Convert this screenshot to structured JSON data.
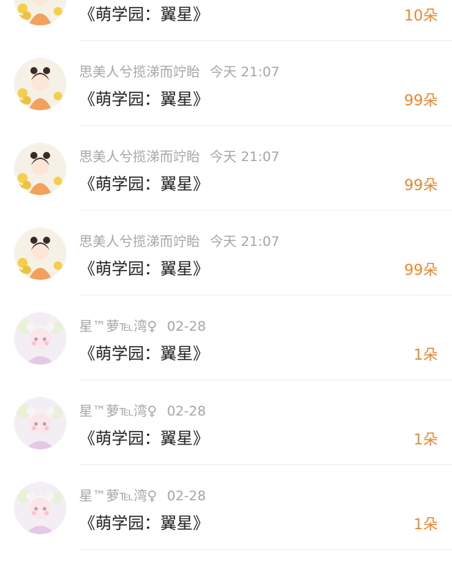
{
  "colors": {
    "accent": "#e8872f",
    "meta_text": "#a6a6a6",
    "title_text": "#222222",
    "divider": "#eeeeee"
  },
  "rows": [
    {
      "avatar": "girl-flowers-avatar",
      "name": "",
      "time": "",
      "title": "《萌学园：翼星》",
      "count": "10朵"
    },
    {
      "avatar": "girl-flowers-avatar",
      "name": "思美人兮揽涕而竚眙",
      "time": "今天 21:07",
      "title": "《萌学园：翼星》",
      "count": "99朵"
    },
    {
      "avatar": "girl-flowers-avatar",
      "name": "思美人兮揽涕而竚眙",
      "time": "今天 21:07",
      "title": "《萌学园：翼星》",
      "count": "99朵"
    },
    {
      "avatar": "girl-flowers-avatar",
      "name": "思美人兮揽涕而竚眙",
      "time": "今天 21:07",
      "title": "《萌学园：翼星》",
      "count": "99朵"
    },
    {
      "avatar": "doll-pink-avatar",
      "name": "星™萝℡湾♀",
      "time": "02-28",
      "title": "《萌学园：翼星》",
      "count": "1朵"
    },
    {
      "avatar": "doll-pink-avatar",
      "name": "星™萝℡湾♀",
      "time": "02-28",
      "title": "《萌学园：翼星》",
      "count": "1朵"
    },
    {
      "avatar": "doll-pink-avatar",
      "name": "星™萝℡湾♀",
      "time": "02-28",
      "title": "《萌学园：翼星》",
      "count": "1朵"
    }
  ]
}
